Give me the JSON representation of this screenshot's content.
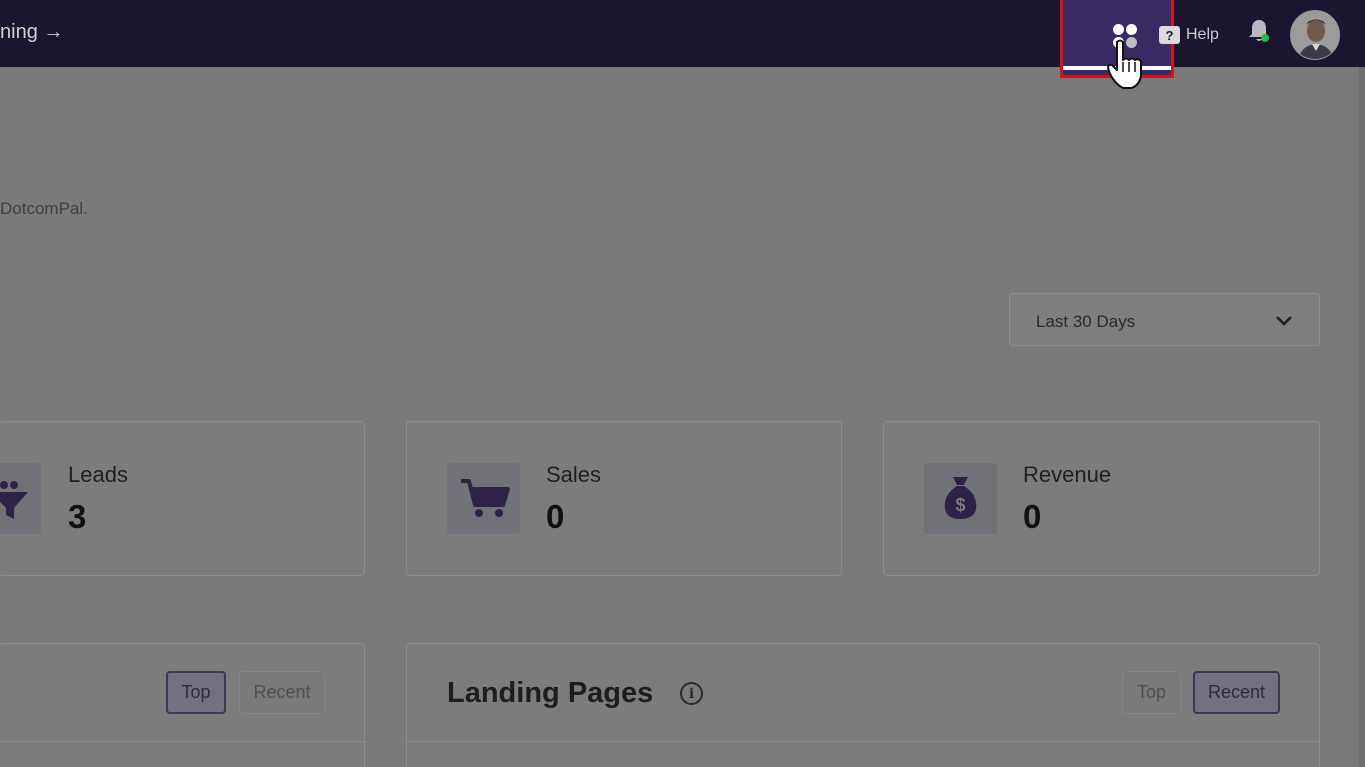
{
  "header": {
    "training_link": "ning →",
    "apps_button": "apps-grid-icon",
    "help_label": "Help",
    "help_icon_glyph": "?",
    "notification_icon": "bell-icon",
    "avatar": "user-avatar"
  },
  "intro": {
    "text": "DotcomPal."
  },
  "filters": {
    "date_range": "Last 30 Days"
  },
  "stats": [
    {
      "label": "Leads",
      "value": "3",
      "icon": "funnel-people-icon"
    },
    {
      "label": "Sales",
      "value": "0",
      "icon": "shopping-cart-icon"
    },
    {
      "label": "Revenue",
      "value": "0",
      "icon": "money-bag-icon"
    }
  ],
  "panels": {
    "left": {
      "tab_top": "Top",
      "tab_recent": "Recent",
      "active_tab": "Top"
    },
    "landing_pages": {
      "title": "Landing Pages",
      "info_glyph": "i",
      "tab_top": "Top",
      "tab_recent": "Recent",
      "active_tab": "Recent"
    }
  },
  "colors": {
    "topbar": "#1c1530",
    "apps_highlight": "#3a2a63",
    "highlight_border": "#d0161b",
    "overlay": "#7a7a7a",
    "online_dot": "#2bb84a"
  }
}
